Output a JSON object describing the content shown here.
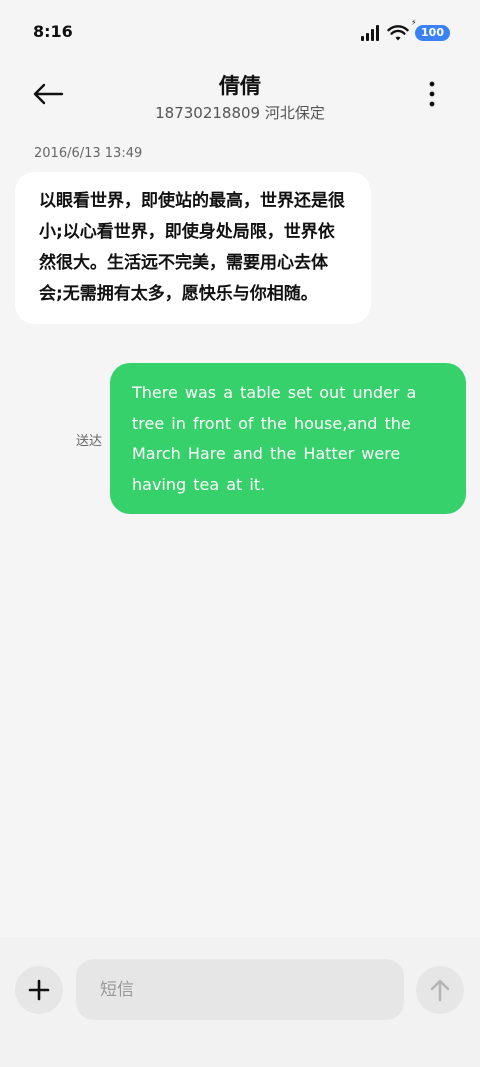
{
  "status_bar": {
    "time": "8:16",
    "battery": "100",
    "icons": [
      "signal-icon",
      "wifi-icon",
      "battery-icon"
    ]
  },
  "header": {
    "back_icon": "arrow-left-icon",
    "contact_name": "倩倩",
    "contact_subtitle": "18730218809  河北保定",
    "more_icon": "more-vertical-icon"
  },
  "conversation": {
    "timestamp": "2016/6/13  13:49",
    "received_message": "以眼看世界，即使站的最高，世界还是很小;以心看世界，即使身处局限，世界依然很大。生活远不完美，需要用心去体会;无需拥有太多，愿快乐与你相随。",
    "sent_status": "送达",
    "sent_message": "There was a table set out under a tree in front of the house,and the March Hare and the Hatter were having tea at it."
  },
  "composer": {
    "add_icon": "plus-icon",
    "placeholder": "短信",
    "value": "",
    "send_icon": "arrow-up-icon"
  },
  "colors": {
    "background": "#f5f5f5",
    "sent_bubble": "#36d16a",
    "received_bubble": "#ffffff",
    "battery_badge": "#3b82f6"
  }
}
